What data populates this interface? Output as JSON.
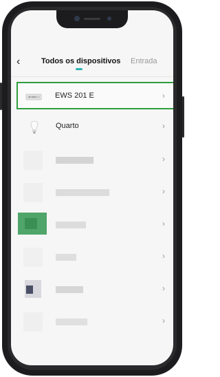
{
  "header": {
    "back_icon": "chevron-left-icon",
    "tab_active": "Todos os dispositivos",
    "tab_inactive": "Entrada"
  },
  "devices": [
    {
      "label": "EWS 201 E",
      "icon": "switch-device-icon",
      "highlighted": true
    },
    {
      "label": "Quarto",
      "icon": "lightbulb-icon",
      "highlighted": false
    }
  ],
  "blurred_rows": 6,
  "colors": {
    "highlight_border": "#2e9e3e",
    "tab_indicator": "#2bb3b3"
  }
}
